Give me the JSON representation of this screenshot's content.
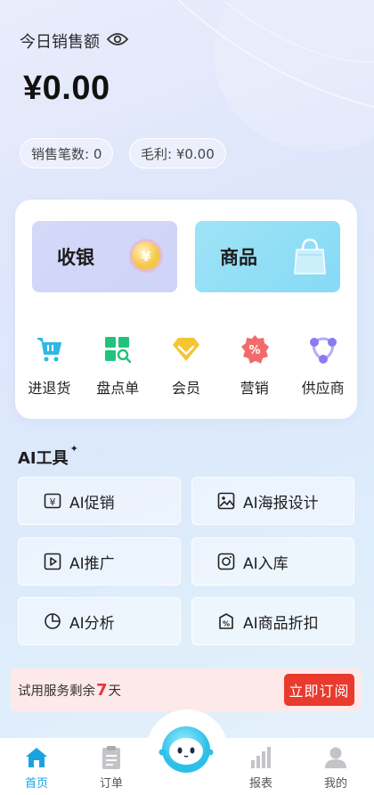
{
  "header": {
    "title": "今日销售额",
    "amount": "¥0.00",
    "sales_count": "销售笔数: 0",
    "gross_profit": "毛利: ¥0.00"
  },
  "main_actions": [
    {
      "label": "收银",
      "icon": "coin-icon"
    },
    {
      "label": "商品",
      "icon": "shopping-bag-icon"
    }
  ],
  "quick_actions": [
    {
      "label": "进退货",
      "icon": "cart-icon",
      "color": "#2fb8e6"
    },
    {
      "label": "盘点单",
      "icon": "inventory-grid-icon",
      "color": "#22c27a"
    },
    {
      "label": "会员",
      "icon": "diamond-icon",
      "color": "#f5c631"
    },
    {
      "label": "营销",
      "icon": "percent-badge-icon",
      "color": "#f26b6b"
    },
    {
      "label": "供应商",
      "icon": "network-icon",
      "color": "#8a7cf0"
    }
  ],
  "ai_tools": {
    "title": "AI工具",
    "spark": "✦",
    "items": [
      {
        "label": "AI促销",
        "icon": "yen-tag-icon"
      },
      {
        "label": "AI海报设计",
        "icon": "image-icon"
      },
      {
        "label": "AI推广",
        "icon": "play-icon"
      },
      {
        "label": "AI入库",
        "icon": "instagram-style-icon"
      },
      {
        "label": "AI分析",
        "icon": "pie-chart-icon"
      },
      {
        "label": "AI商品折扣",
        "icon": "discount-tag-icon"
      }
    ]
  },
  "trial": {
    "prefix": "试用服务剩余",
    "days": "7",
    "suffix": "天",
    "subscribe": "立即订阅"
  },
  "bottom_nav": [
    {
      "label": "首页",
      "icon": "home-icon",
      "active": true
    },
    {
      "label": "订单",
      "icon": "clipboard-icon"
    },
    {
      "label": "",
      "icon": "robot-assistant-icon"
    },
    {
      "label": "报表",
      "icon": "bar-chart-icon"
    },
    {
      "label": "我的",
      "icon": "person-icon"
    }
  ],
  "colors": {
    "accent_blue": "#1aa3e0",
    "alert_red": "#ea3a2e",
    "cashier_bg": "#d4d8f9",
    "goods_bg": "#9fe3f7"
  }
}
